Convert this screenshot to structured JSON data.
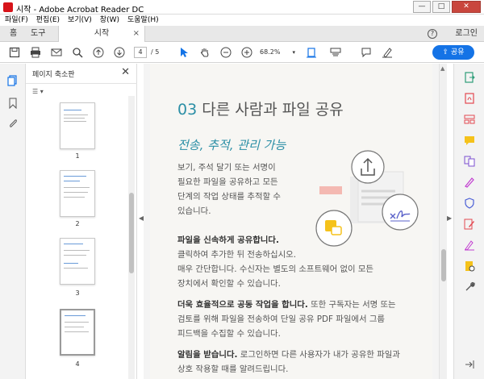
{
  "window": {
    "title": "시작 - Adobe Acrobat Reader DC",
    "min": "—",
    "max": "□",
    "close": "✕"
  },
  "menu": [
    "파일(F)",
    "편집(E)",
    "보기(V)",
    "창(W)",
    "도움말(H)"
  ],
  "tabs": {
    "home": "홈",
    "tools": "도구",
    "document": "시작",
    "close": "×",
    "help": "?",
    "login": "로그인"
  },
  "toolbar": {
    "page_current": "4",
    "page_total": "/ 5",
    "zoom": "68.2%",
    "share_label": "공유"
  },
  "thumb_panel": {
    "title": "페이지 축소판",
    "close": "✕",
    "options": "☰ ▾",
    "pages": [
      "1",
      "2",
      "3",
      "4"
    ]
  },
  "document": {
    "heading_num": "03",
    "heading_text": "다른 사람과 파일 공유",
    "subheading": "전송, 추적, 관리 가능",
    "intro": [
      "보기, 주석 달기 또는 서명이",
      "필요한 파일을 공유하고 모든",
      "단계의 작업 상태를 추적할 수",
      "있습니다."
    ],
    "p1_title": "파일을 신속하게 공유합니다.",
    "p1_lines": [
      "클릭하여 추가한 뒤 전송하십시오.",
      "매우 간단합니다. 수신자는 별도의 소프트웨어 없이 모든",
      "장치에서 확인할 수 있습니다."
    ],
    "p2_title": "더욱 효율적으로 공동 작업을 합니다.",
    "p2_line1_rest": " 또한 구독자는 서명 또는",
    "p2_lines": [
      "검토를 위해 파일을 전송하여 단일 공유 PDF 파일에서 그룹",
      "피드백을 수집할 수 있습니다."
    ],
    "p3_title": "알림을 받습니다.",
    "p3_line1_rest": " 로그인하면 다른 사용자가 내가 공유한 파일과",
    "p3_lines": [
      "상호 작용할 때를 알려드립니다."
    ]
  },
  "colors": {
    "accent": "#1473e6",
    "teal": "#2c8fa6"
  }
}
